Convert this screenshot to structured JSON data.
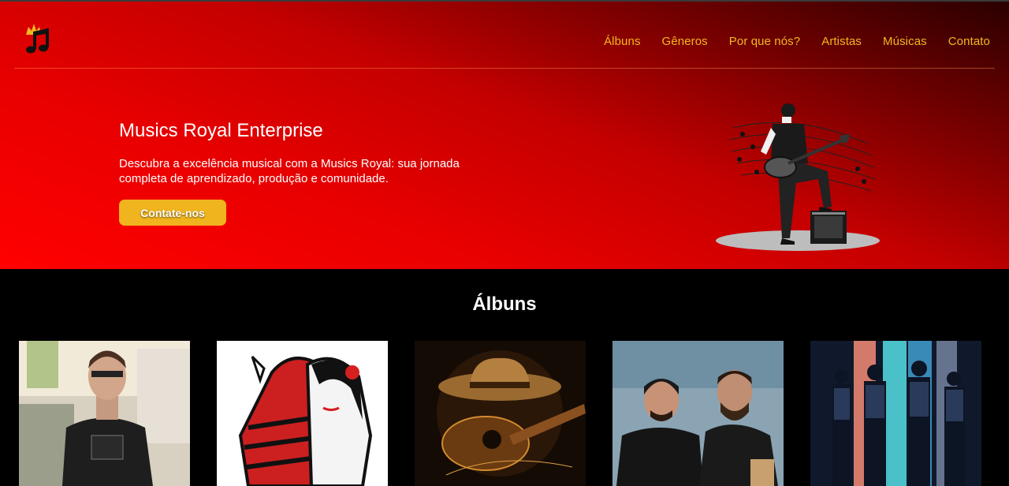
{
  "brand": {
    "logo_icon": "music-note-crown-icon"
  },
  "nav": {
    "items": [
      {
        "label": "Álbuns"
      },
      {
        "label": "Gêneros"
      },
      {
        "label": "Por que nós?"
      },
      {
        "label": "Artistas"
      },
      {
        "label": "Músicas"
      },
      {
        "label": "Contato"
      }
    ]
  },
  "hero": {
    "title": "Musics Royal Enterprise",
    "description": "Descubra a excelência musical com a Musics Royal: sua jornada completa de aprendizado, produção e comunidade.",
    "cta_label": "Contate-nos"
  },
  "albums_section": {
    "title": "Álbuns",
    "items": [
      {
        "image": "singer-portrait-photo"
      },
      {
        "image": "embracing-couple-illustration"
      },
      {
        "image": "cowboy-hat-guitar-art"
      },
      {
        "image": "duo-on-stage-photo"
      },
      {
        "image": "band-group-photo"
      }
    ]
  },
  "colors": {
    "accent": "#f2b81e",
    "hero_red": "#e80000",
    "background": "#000000"
  }
}
